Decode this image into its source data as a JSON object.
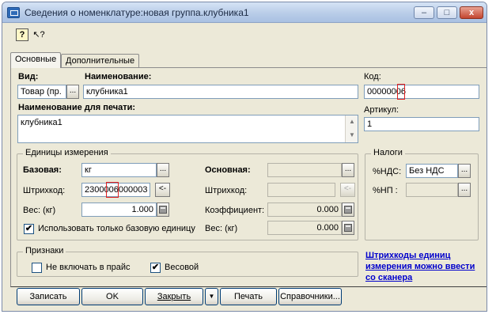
{
  "window": {
    "title": "Сведения о номенклатуре:новая группа.клубника1",
    "minimize": "–",
    "maximize": "□",
    "close": "x"
  },
  "toolbar": {
    "help_icon": "?",
    "pointer_icon": "↖?"
  },
  "tabs": [
    {
      "label": "Основные",
      "active": true
    },
    {
      "label": "Дополнительные",
      "active": false
    }
  ],
  "main": {
    "vid_label": "Вид:",
    "vid_value": "Товар (пр.",
    "naim_label": "Наименование:",
    "naim_value": "клубника1",
    "kod_label": "Код:",
    "kod_value": "00000006",
    "print_label": "Наименование для печати:",
    "print_value": "клубника1",
    "artikul_label": "Артикул:",
    "artikul_value": "1"
  },
  "units": {
    "group_title": "Единицы измерения",
    "base_label": "Базовая:",
    "base_value": "кг",
    "barcode_label": "Штрихкод:",
    "barcode_value": "2300006000003",
    "barcode_btn": "<-",
    "weight_label": "Вес: (кг)",
    "weight_value": "1.000",
    "only_base_label": "Использовать только базовую единицу",
    "only_base_checked": "✔",
    "main_label": "Основная:",
    "main_value": "",
    "main_barcode_label": "Штрихкод:",
    "main_barcode_value": "",
    "main_barcode_btn": "<-",
    "coef_label": "Коэффициент:",
    "coef_value": "0.000",
    "main_weight_label": "Вес: (кг)",
    "main_weight_value": "0.000"
  },
  "taxes": {
    "group_title": "Налоги",
    "nds_label": "%НДС:",
    "nds_value": "Без НДС",
    "np_label": "%НП :",
    "np_value": ""
  },
  "features": {
    "group_title": "Признаки",
    "not_in_price_label": "Не включать в прайс",
    "weighted_label": "Весовой",
    "weighted_checked": "✔"
  },
  "hint_link": [
    "Штрихкоды единиц",
    "измерения можно ввести",
    "со сканера"
  ],
  "buttons": {
    "save": "Записать",
    "ok": "OK",
    "close": "Закрыть",
    "dropdown": "▼",
    "print": "Печать",
    "refs": "Справочники..."
  },
  "ellipsis": "...",
  "colors": {
    "highlight": "#e02020",
    "link": "#0000cc"
  }
}
